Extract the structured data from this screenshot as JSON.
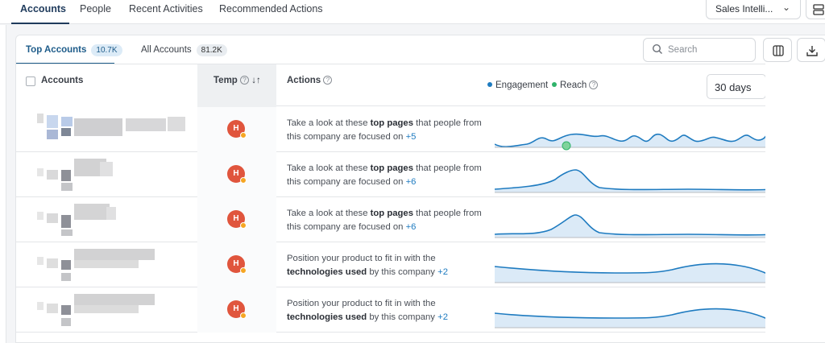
{
  "topnav": {
    "tabs": [
      "Accounts",
      "People",
      "Recent Activities",
      "Recommended Actions"
    ],
    "select_value": "Sales Intelli..."
  },
  "subnav": {
    "tabs": [
      {
        "label": "Top Accounts",
        "count": "10.7K"
      },
      {
        "label": "All Accounts",
        "count": "81.2K"
      }
    ],
    "search_placeholder": "Search"
  },
  "table": {
    "headers": {
      "accounts": "Accounts",
      "temp": "Temp",
      "actions": "Actions"
    },
    "legend": [
      {
        "label": "Engagement",
        "color": "#1e7bc0"
      },
      {
        "label": "Reach",
        "color": "#2fb36a"
      }
    ],
    "range": "30 days",
    "temp_letter": "H",
    "rows": [
      {
        "pre": "Take a look at these ",
        "bold": "top pages",
        "post": " that people from this company are focused on ",
        "more": "+5"
      },
      {
        "pre": "Take a look at these ",
        "bold": "top pages",
        "post": " that people from this company are focused on ",
        "more": "+6"
      },
      {
        "pre": "Take a look at these ",
        "bold": "top pages",
        "post": " that people from this company are focused on ",
        "more": "+6"
      },
      {
        "pre": "Position your product to fit in with the ",
        "bold": "technologies used",
        "post": " by this company ",
        "more": "+2"
      },
      {
        "pre": "Position your product to fit in with the ",
        "bold": "technologies used",
        "post": " by this company ",
        "more": "+2"
      }
    ]
  }
}
